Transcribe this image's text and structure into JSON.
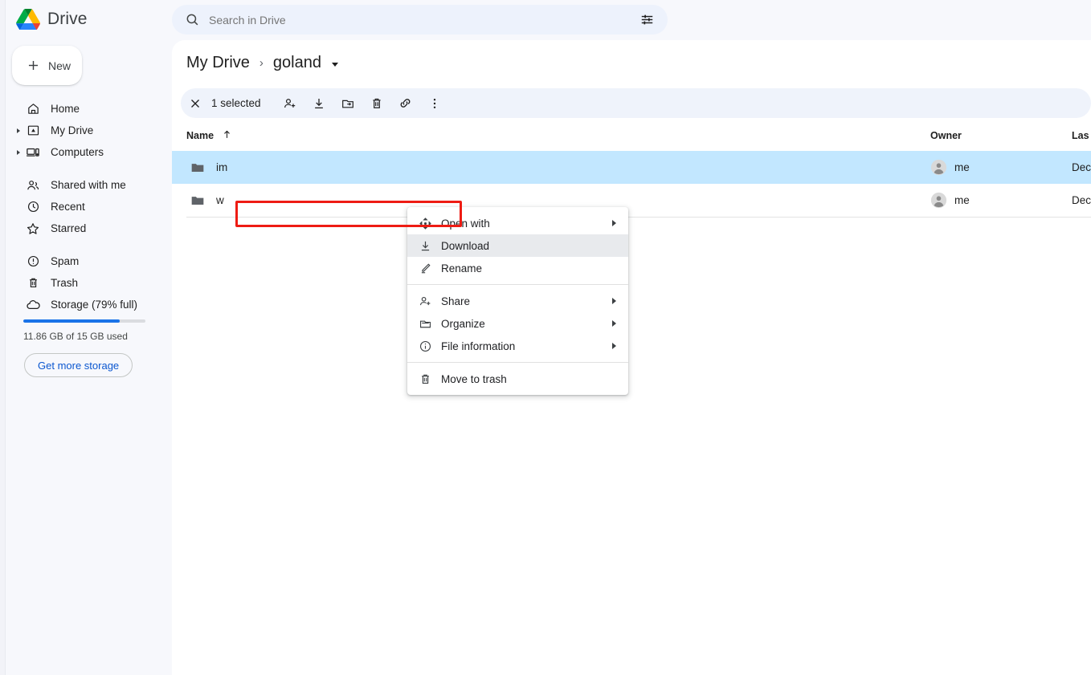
{
  "app": {
    "name": "Drive",
    "logo_icon": "drive-logo-icon"
  },
  "new_button": {
    "label": "New",
    "icon": "plus-icon"
  },
  "search": {
    "placeholder": "Search in Drive",
    "value": "",
    "icon": "search-icon",
    "filter_icon": "tune-icon"
  },
  "sidebar": {
    "items": [
      {
        "label": "Home",
        "icon": "home-icon",
        "expandable": false
      },
      {
        "label": "My Drive",
        "icon": "my-drive-icon",
        "expandable": true
      },
      {
        "label": "Computers",
        "icon": "computers-icon",
        "expandable": true
      },
      {
        "label": "Shared with me",
        "icon": "people-icon",
        "expandable": false
      },
      {
        "label": "Recent",
        "icon": "clock-icon",
        "expandable": false
      },
      {
        "label": "Starred",
        "icon": "star-icon",
        "expandable": false
      },
      {
        "label": "Spam",
        "icon": "spam-icon",
        "expandable": false
      },
      {
        "label": "Trash",
        "icon": "trash-icon",
        "expandable": false
      },
      {
        "label": "Storage (79% full)",
        "icon": "cloud-icon",
        "expandable": false
      }
    ],
    "storage": {
      "percent": 79,
      "used_text": "11.86 GB of 15 GB used",
      "cta_label": "Get more storage",
      "bar_color": "#1a73e8"
    }
  },
  "breadcrumb": {
    "root": "My Drive",
    "separator": "›",
    "current": "goland",
    "caret_icon": "chevron-down-icon"
  },
  "selection_toolbar": {
    "close_icon": "close-icon",
    "count_label": "1 selected",
    "actions": [
      {
        "name": "share-action",
        "icon": "person-add-icon"
      },
      {
        "name": "download-action",
        "icon": "download-icon"
      },
      {
        "name": "move-action",
        "icon": "move-to-folder-icon"
      },
      {
        "name": "trash-action",
        "icon": "trash-icon"
      },
      {
        "name": "copy-link-action",
        "icon": "link-icon"
      },
      {
        "name": "more-action",
        "icon": "more-vert-icon"
      }
    ]
  },
  "table": {
    "columns": {
      "name": "Name",
      "owner": "Owner",
      "last_modified": "Las"
    },
    "sort_icon": "arrow-up-icon",
    "rows": [
      {
        "name": "im",
        "icon": "folder-icon",
        "owner": "me",
        "owner_avatar": "account-circle-icon",
        "last_modified": "Dec",
        "selected": true
      },
      {
        "name": "w",
        "icon": "folder-icon",
        "owner": "me",
        "owner_avatar": "account-circle-icon",
        "last_modified": "Dec",
        "selected": false
      }
    ]
  },
  "context_menu": {
    "items": [
      {
        "label": "Open with",
        "icon": "open-with-icon",
        "submenu": true,
        "highlighted": false
      },
      {
        "label": "Download",
        "icon": "download-icon",
        "submenu": false,
        "highlighted": true
      },
      {
        "label": "Rename",
        "icon": "pencil-icon",
        "submenu": false,
        "highlighted": false
      },
      {
        "label": "Share",
        "icon": "person-add-icon",
        "submenu": true,
        "highlighted": false
      },
      {
        "label": "Organize",
        "icon": "folder-move-icon",
        "submenu": true,
        "highlighted": false
      },
      {
        "label": "File information",
        "icon": "info-icon",
        "submenu": true,
        "highlighted": false
      },
      {
        "label": "Move to trash",
        "icon": "trash-icon",
        "submenu": false,
        "highlighted": false
      }
    ]
  },
  "annotation": {
    "highlight_color": "#ee1c14",
    "target": "Download"
  }
}
